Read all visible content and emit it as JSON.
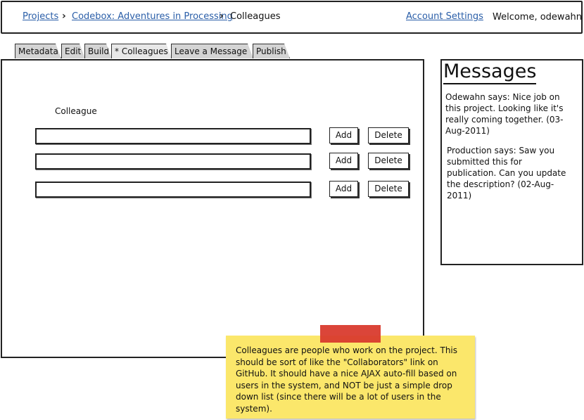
{
  "header": {
    "breadcrumb": [
      "Projects",
      "Codebox: Adventures in Processing"
    ],
    "current_page": "Colleagues",
    "account_settings": "Account Settings",
    "welcome": "Welcome, odewahn"
  },
  "tabs": [
    {
      "label": "Metadata"
    },
    {
      "label": "Edit"
    },
    {
      "label": "Build"
    },
    {
      "label": "* Colleagues",
      "active": true
    },
    {
      "label": "Leave a Message"
    },
    {
      "label": "Publish"
    }
  ],
  "main": {
    "colleague_label": "Colleague",
    "rows": [
      {
        "value": "",
        "add_label": "Add",
        "delete_label": "Delete"
      },
      {
        "value": "",
        "add_label": "Add",
        "delete_label": "Delete"
      },
      {
        "value": "",
        "add_label": "Add",
        "delete_label": "Delete"
      }
    ]
  },
  "messages": {
    "title": "Messages",
    "items": [
      {
        "text": "Odewahn says: Nice job on this project.  Looking like it's really coming together. (03-Aug-2011)"
      },
      {
        "text": "Production says: Saw you submitted this for publication. Can you update the description? (02-Aug-2011)"
      }
    ]
  },
  "note": {
    "text": "Colleagues are people who work on the project.  This should be sort of like the \"Collaborators\" link on GitHub.  It should have a nice AJAX auto-fill based on users in the system, and NOT be just a simple drop down list (since there will be a lot of users in the system)."
  },
  "colors": {
    "link": "#2a5ea8",
    "tab": "#d4d4d4",
    "note": "#fbe76b",
    "tape": "#d93b2e"
  },
  "icons": [
    "chevron-right-icon"
  ]
}
